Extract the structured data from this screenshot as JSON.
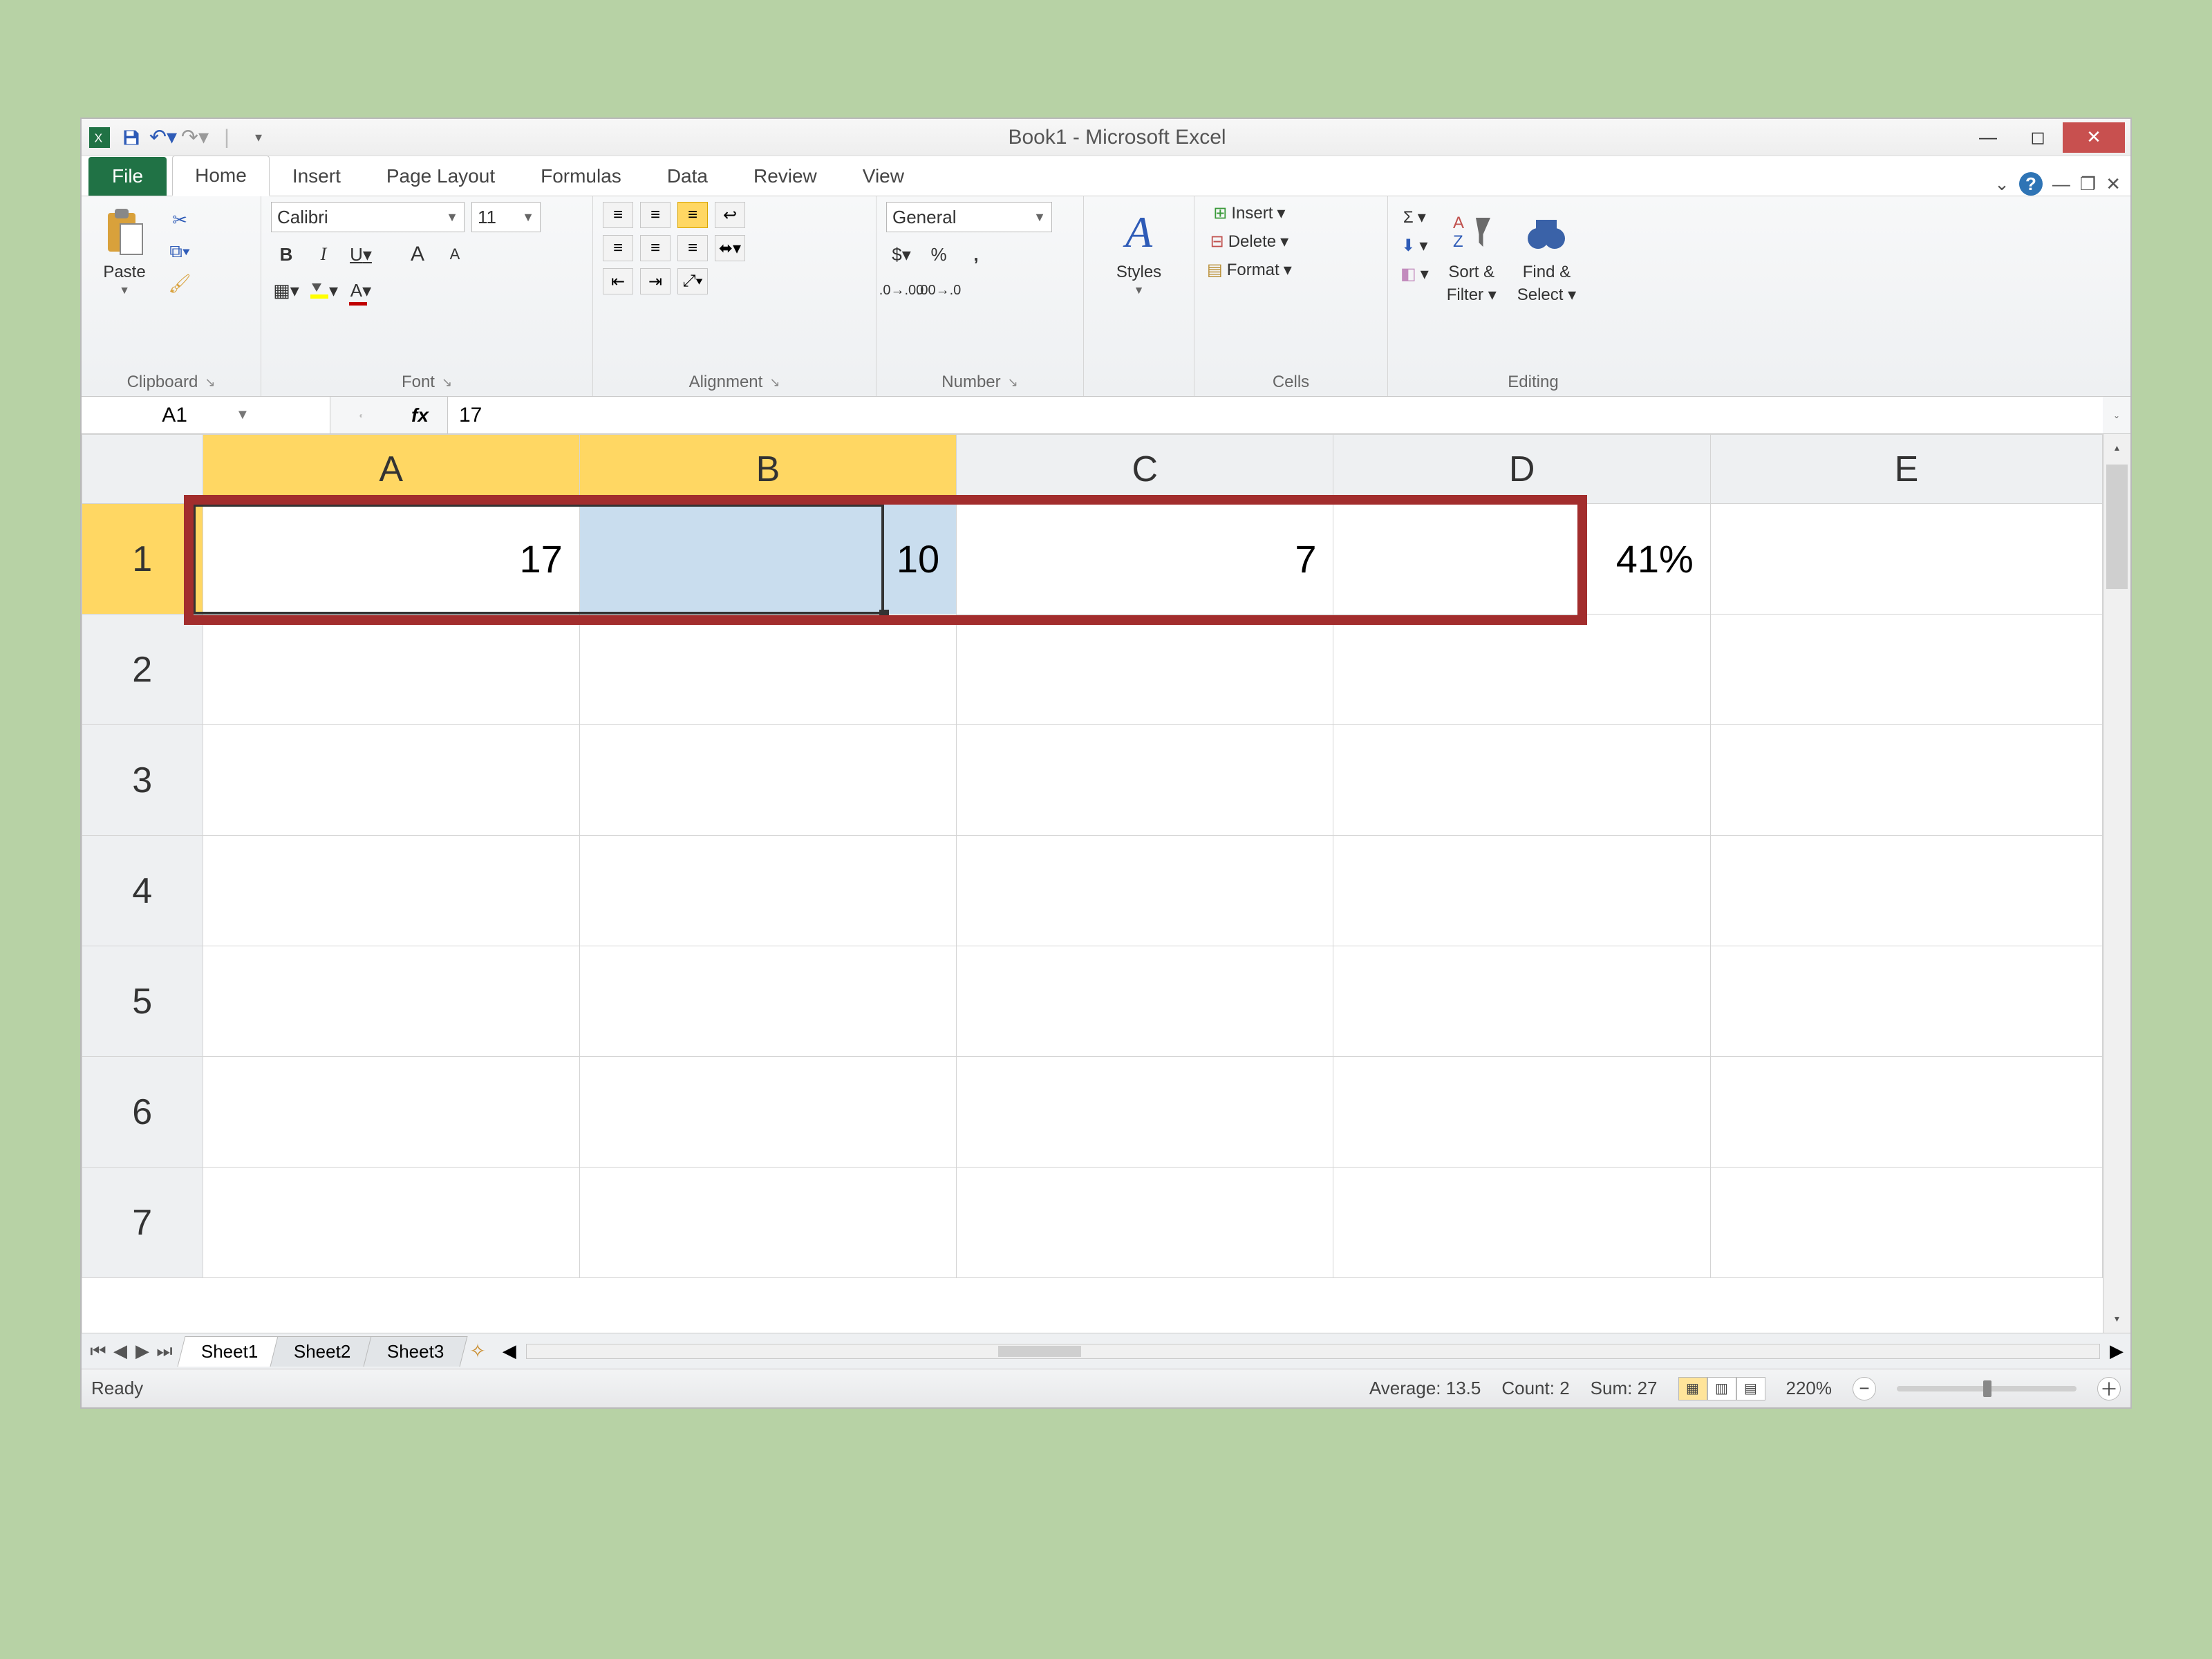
{
  "title": "Book1 - Microsoft Excel",
  "qat": {
    "save": "save-icon",
    "undo": "undo-icon",
    "redo": "redo-icon"
  },
  "tabs": {
    "file": "File",
    "list": [
      "Home",
      "Insert",
      "Page Layout",
      "Formulas",
      "Data",
      "Review",
      "View"
    ],
    "active": "Home"
  },
  "ribbon": {
    "clipboard": {
      "paste": "Paste",
      "label": "Clipboard"
    },
    "font": {
      "name": "Calibri",
      "size": "11",
      "bold": "B",
      "italic": "I",
      "underline": "U",
      "grow": "A",
      "shrink": "A",
      "label": "Font"
    },
    "alignment": {
      "label": "Alignment"
    },
    "number": {
      "format": "General",
      "currency": "$",
      "percent": "%",
      "comma": ",",
      "inc": "increase-decimal",
      "dec": "decrease-decimal",
      "label": "Number"
    },
    "styles": {
      "btn": "Styles"
    },
    "cells": {
      "insert": "Insert",
      "delete": "Delete",
      "format": "Format",
      "label": "Cells"
    },
    "editing": {
      "sortfilter1": "Sort &",
      "sortfilter2": "Filter",
      "findselect1": "Find &",
      "findselect2": "Select",
      "label": "Editing"
    }
  },
  "formula": {
    "ref": "A1",
    "fx": "fx",
    "value": "17"
  },
  "columns": [
    "A",
    "B",
    "C",
    "D",
    "E"
  ],
  "rows": [
    "1",
    "2",
    "3",
    "4",
    "5",
    "6",
    "7"
  ],
  "cells": {
    "A1": "17",
    "B1": "10",
    "C1": "7",
    "D1": "41%"
  },
  "sheets": {
    "nav": [
      "⏮",
      "◀",
      "▶",
      "⏭"
    ],
    "tabs": [
      "Sheet1",
      "Sheet2",
      "Sheet3"
    ],
    "active": "Sheet1"
  },
  "status": {
    "ready": "Ready",
    "average_label": "Average:",
    "average": "13.5",
    "count_label": "Count:",
    "count": "2",
    "sum_label": "Sum:",
    "sum": "27",
    "zoom": "220%"
  }
}
